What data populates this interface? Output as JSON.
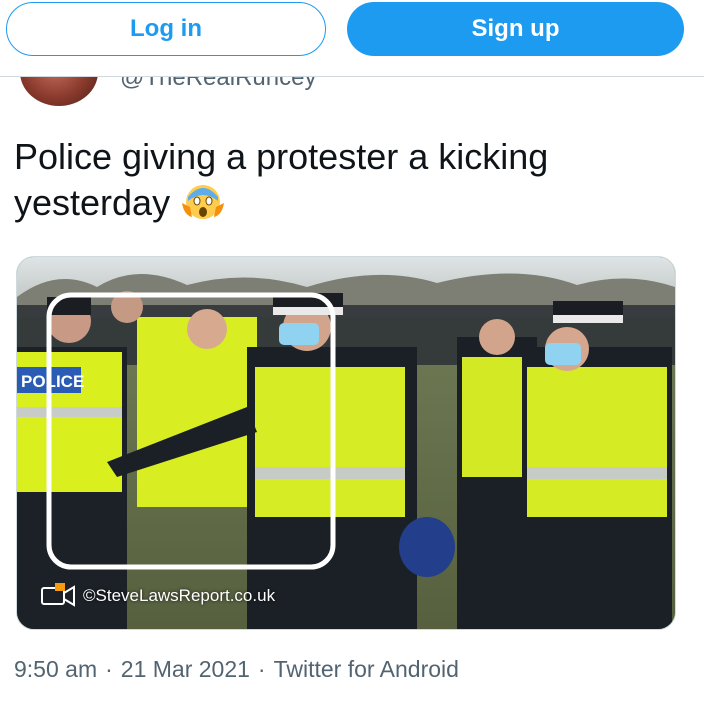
{
  "header": {
    "login_label": "Log in",
    "signup_label": "Sign up",
    "accent_color": "#1d9bf0"
  },
  "author": {
    "handle": "@TheRealRuncey",
    "avatar_icon": "avatar"
  },
  "tweet": {
    "text": "Police giving a protester a kicking yesterday",
    "emoji": "face-screaming-in-fear-emoji"
  },
  "media": {
    "watermark": "©SteveLawsReport.co.uk",
    "vest_text": "POLICE"
  },
  "meta": {
    "time": "9:50 am",
    "sep1": "·",
    "date": "21 Mar 2021",
    "sep2": "·",
    "source": "Twitter for Android"
  }
}
